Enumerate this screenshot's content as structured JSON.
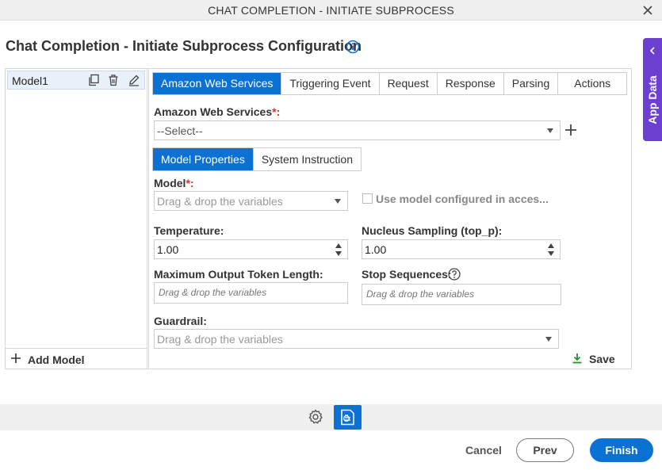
{
  "window": {
    "title": "CHAT COMPLETION - INITIATE SUBPROCESS"
  },
  "page": {
    "title": "Chat Completion - Initiate Subprocess Configuration"
  },
  "side_tab": {
    "label": "App Data"
  },
  "models": {
    "items": [
      {
        "name": "Model1"
      }
    ],
    "add_label": "Add Model"
  },
  "tabs": [
    {
      "label": "Amazon Web Services",
      "active": true
    },
    {
      "label": "Triggering Event"
    },
    {
      "label": "Request"
    },
    {
      "label": "Response"
    },
    {
      "label": "Parsing"
    },
    {
      "label": "Actions"
    }
  ],
  "aws": {
    "label": "Amazon Web Services",
    "required_mark": "*:",
    "value": "--Select--"
  },
  "subtabs": [
    {
      "label": "Model Properties",
      "active": true
    },
    {
      "label": "System Instruction"
    }
  ],
  "model_field": {
    "label": "Model",
    "required_mark": "*:",
    "placeholder": "Drag & drop the variables"
  },
  "use_model_checkbox": {
    "label": "Use model configured in acces...",
    "checked": false
  },
  "temperature": {
    "label": "Temperature:",
    "value": "1.00"
  },
  "top_p": {
    "label": "Nucleus Sampling (top_p):",
    "value": "1.00"
  },
  "max_tokens": {
    "label": "Maximum Output Token Length:",
    "placeholder": "Drag & drop the variables"
  },
  "stop_sequences": {
    "label": "Stop Sequences:",
    "placeholder": "Drag & drop the variables"
  },
  "guardrail": {
    "label": "Guardrail:",
    "placeholder": "Drag & drop the variables"
  },
  "save_label": "Save",
  "footer": {
    "cancel": "Cancel",
    "prev": "Prev",
    "finish": "Finish"
  },
  "colors": {
    "primary": "#0b71d3",
    "app_data": "#6d3fd1",
    "save_icon": "#2e8b3a",
    "required": "#d32f2f"
  }
}
